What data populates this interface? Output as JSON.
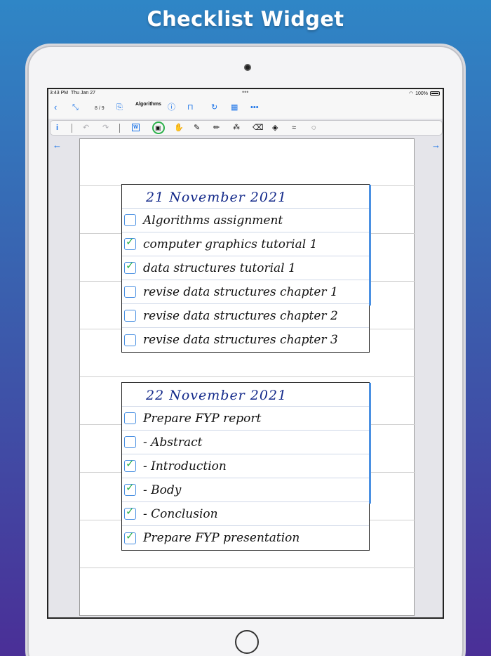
{
  "headline": "Checklist Widget",
  "status": {
    "time": "3:43 PM",
    "date": "Thu Jan 27",
    "battery": "100%"
  },
  "nav": {
    "page_indicator": "8 / 9",
    "notebook_title": "Algorithms"
  },
  "checklists": [
    {
      "date": "21 November 2021",
      "items": [
        {
          "text": "Algorithms assignment",
          "checked": false
        },
        {
          "text": "computer graphics tutorial 1",
          "checked": true
        },
        {
          "text": "data structures tutorial 1",
          "checked": true
        },
        {
          "text": "revise data structures chapter 1",
          "checked": false
        },
        {
          "text": "revise data structures chapter 2",
          "checked": false
        },
        {
          "text": "revise data structures chapter 3",
          "checked": false
        }
      ]
    },
    {
      "date": "22 November 2021",
      "items": [
        {
          "text": "Prepare FYP report",
          "checked": false
        },
        {
          "text": "- Abstract",
          "checked": false
        },
        {
          "text": "- Introduction",
          "checked": true
        },
        {
          "text": "- Body",
          "checked": true
        },
        {
          "text": "- Conclusion",
          "checked": true
        },
        {
          "text": "Prepare FYP presentation",
          "checked": true
        }
      ]
    }
  ],
  "colors": {
    "accent": "#1a73e8",
    "check": "#2bb04a",
    "ink": "#13298a"
  }
}
